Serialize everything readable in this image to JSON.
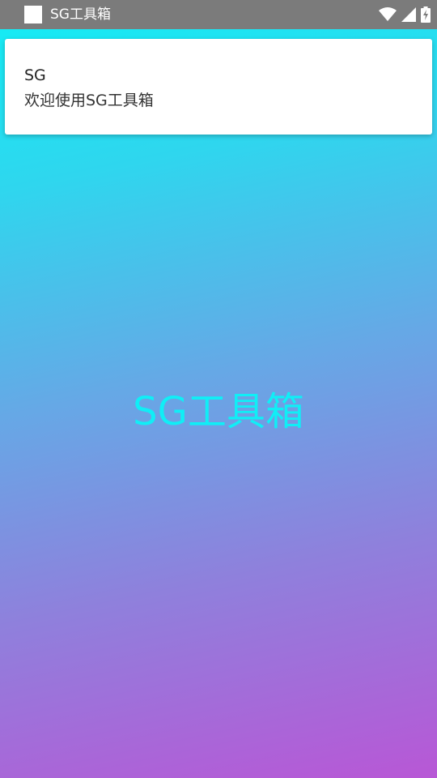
{
  "status_bar": {
    "app_title": "SG工具箱",
    "icons": [
      "app-icon",
      "wifi-icon",
      "signal-icon",
      "battery-charging-icon"
    ],
    "background_color": "#7b7b7b"
  },
  "notification": {
    "title": "SG",
    "text": "欢迎使用SG工具箱"
  },
  "main": {
    "title": "SG工具箱",
    "title_color": "#10eef6",
    "gradient_colors": [
      "#12eef5",
      "#66a8e6",
      "#b857d6"
    ]
  }
}
